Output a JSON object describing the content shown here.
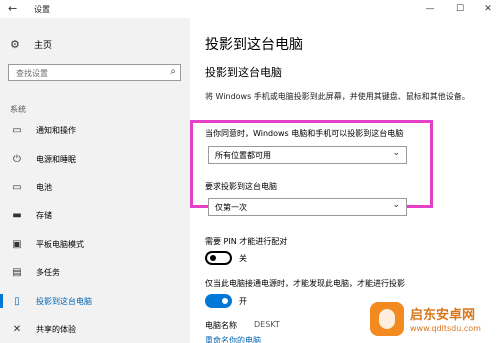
{
  "window": {
    "back_glyph": "←",
    "title": "设置",
    "minimize_glyph": "—",
    "maximize_glyph": "☐",
    "close_glyph": "✕"
  },
  "sidebar": {
    "home_label": "主页",
    "search_placeholder": "查找设置",
    "section_label": "系统",
    "items": [
      {
        "label": "通知和操作",
        "icon": "notification-icon"
      },
      {
        "label": "电源和睡眠",
        "icon": "power-icon"
      },
      {
        "label": "电池",
        "icon": "battery-icon"
      },
      {
        "label": "存储",
        "icon": "storage-icon"
      },
      {
        "label": "平板电脑模式",
        "icon": "tablet-mode-icon"
      },
      {
        "label": "多任务",
        "icon": "multitasking-icon"
      },
      {
        "label": "投影到这台电脑",
        "icon": "projecting-icon",
        "active": true
      },
      {
        "label": "共享的体验",
        "icon": "shared-experience-icon"
      }
    ]
  },
  "main": {
    "page_title": "投影到这台电脑",
    "section_title": "投影到这台电脑",
    "description": "将 Windows 手机或电脑投影到此屏幕，并使用其键盘、鼠标和其他设备。",
    "setting1": {
      "label": "当你同意时，Windows 电脑和手机可以投影到这台电脑",
      "value": "所有位置都可用"
    },
    "setting2": {
      "label": "要求投影到这台电脑",
      "value": "仅第一次"
    },
    "pin": {
      "label": "需要 PIN 才能进行配对",
      "state": "关"
    },
    "power": {
      "label": "仅当此电脑接通电源时，才能发现此电脑，才能进行投影",
      "state": "开"
    },
    "pc_name_label": "电脑名称",
    "pc_name_value": "DESKT",
    "rename_link": "重命名你的电脑"
  },
  "watermark": {
    "line1": "启东安卓网",
    "line2": "www.qdltsdu.com"
  },
  "colors": {
    "accent": "#0078d7",
    "highlight": "#e33fc8",
    "sidebar_bg": "#f2f2f2"
  }
}
